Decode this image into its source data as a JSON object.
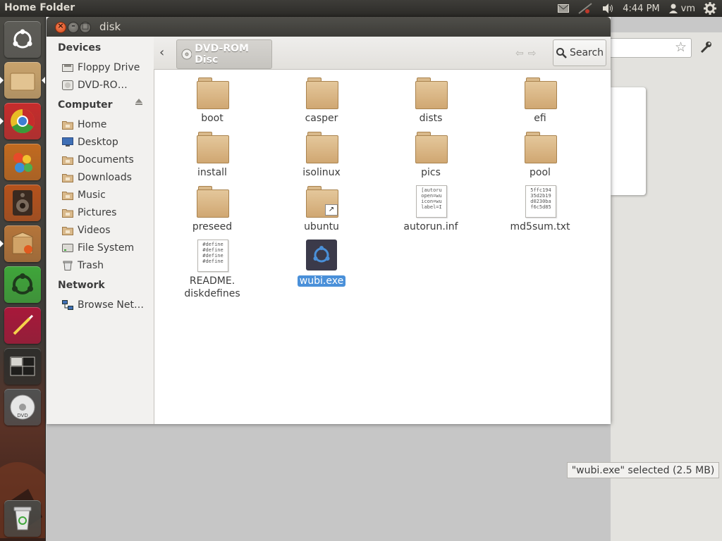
{
  "top_panel": {
    "title": "Home Folder",
    "clock": "4:44 PM",
    "user": "vm"
  },
  "window": {
    "title": "disk",
    "path_button": "DVD-ROM Disc",
    "search_label": "Search",
    "status": "\"wubi.exe\" selected (2.5 MB)"
  },
  "sidebar": {
    "devices_heading": "Devices",
    "devices": [
      {
        "label": "Floppy Drive",
        "icon": "floppy-drive-icon"
      },
      {
        "label": "DVD-RO…",
        "icon": "dvd-drive-icon"
      }
    ],
    "computer_heading": "Computer",
    "computer": [
      {
        "label": "Home",
        "icon": "home-folder-icon"
      },
      {
        "label": "Desktop",
        "icon": "desktop-icon"
      },
      {
        "label": "Documents",
        "icon": "documents-folder-icon"
      },
      {
        "label": "Downloads",
        "icon": "downloads-folder-icon"
      },
      {
        "label": "Music",
        "icon": "music-folder-icon"
      },
      {
        "label": "Pictures",
        "icon": "pictures-folder-icon"
      },
      {
        "label": "Videos",
        "icon": "videos-folder-icon"
      },
      {
        "label": "File System",
        "icon": "file-system-icon"
      },
      {
        "label": "Trash",
        "icon": "trash-icon"
      }
    ],
    "network_heading": "Network",
    "network": [
      {
        "label": "Browse Net…",
        "icon": "network-icon"
      }
    ]
  },
  "files": [
    {
      "name": "boot",
      "type": "folder"
    },
    {
      "name": "casper",
      "type": "folder"
    },
    {
      "name": "dists",
      "type": "folder"
    },
    {
      "name": "efi",
      "type": "folder"
    },
    {
      "name": "install",
      "type": "folder"
    },
    {
      "name": "isolinux",
      "type": "folder"
    },
    {
      "name": "pics",
      "type": "folder"
    },
    {
      "name": "pool",
      "type": "folder"
    },
    {
      "name": "preseed",
      "type": "folder"
    },
    {
      "name": "ubuntu",
      "type": "folder-link"
    },
    {
      "name": "autorun.inf",
      "type": "text",
      "preview": "[autoru\nopen=wu\nicon=wu\nlabel=I"
    },
    {
      "name": "md5sum.txt",
      "type": "text",
      "preview": "5ffc194\n35d2b19\nd0230ba\nf6c5d85"
    },
    {
      "name": "README.\ndiskdefines",
      "type": "text",
      "preview": "#define\n#define\n#define\n#define"
    },
    {
      "name": "wubi.exe",
      "type": "exe",
      "selected": true
    }
  ],
  "launcher": [
    {
      "name": "dash-home-icon",
      "color": "#5d5c57"
    },
    {
      "name": "home-folder-launcher-icon",
      "color": "#c9a36c"
    },
    {
      "name": "chromium-browser-icon",
      "color": "#c62c2c"
    },
    {
      "name": "paint-app-icon",
      "color": "#c26a1f"
    },
    {
      "name": "speaker-app-icon",
      "color": "#b5521c"
    },
    {
      "name": "software-center-icon",
      "color": "#b5753a"
    },
    {
      "name": "ubuntu-one-icon",
      "color": "#3fa63a"
    },
    {
      "name": "text-editor-icon",
      "color": "#a8183a"
    },
    {
      "name": "workspace-switcher-icon",
      "color": "#2f2e2b"
    },
    {
      "name": "dvd-launcher-icon",
      "color": "#505050"
    },
    {
      "name": "trash-launcher-icon",
      "color": "#4a4945"
    }
  ],
  "colors": {
    "selection": "#4a90d9",
    "panel": "#3c3b37",
    "folder": "#d9b98b"
  }
}
